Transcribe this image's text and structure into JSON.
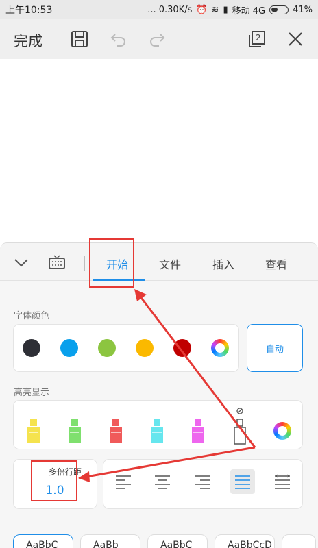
{
  "status_bar": {
    "time": "上午10:53",
    "right_text": "... 0.30K/s",
    "carrier": "移动 4G",
    "battery": "41%"
  },
  "toolbar": {
    "done_label": "完成",
    "page_count": "2",
    "icons": [
      "save-icon",
      "undo-icon",
      "redo-icon",
      "page-switch-icon",
      "close-icon"
    ]
  },
  "tabs": {
    "items": [
      {
        "label": "开始",
        "active": true
      },
      {
        "label": "文件",
        "active": false
      },
      {
        "label": "插入",
        "active": false
      },
      {
        "label": "查看",
        "active": false
      }
    ]
  },
  "font_color": {
    "label": "字体颜色",
    "colors": [
      "#2e2f36",
      "#09a0ec",
      "#8cc540",
      "#fbb900",
      "#c00000"
    ],
    "auto_label": "自动"
  },
  "highlight": {
    "label": "高亮显示",
    "colors": [
      "#f5e34e",
      "#7fe06e",
      "#f05a5a",
      "#66e6ee",
      "#ee66ee"
    ]
  },
  "line_spacing": {
    "label": "多倍行距",
    "value": "1.0"
  },
  "font_samples": [
    {
      "text": "AaBbC",
      "selected": true
    },
    {
      "text": "AaBb",
      "selected": false
    },
    {
      "text": "AaBbC",
      "selected": false
    },
    {
      "text": "AaBbCcD",
      "selected": false
    }
  ],
  "accent_color": "#1f8ee8",
  "annotation_color": "#e53935"
}
